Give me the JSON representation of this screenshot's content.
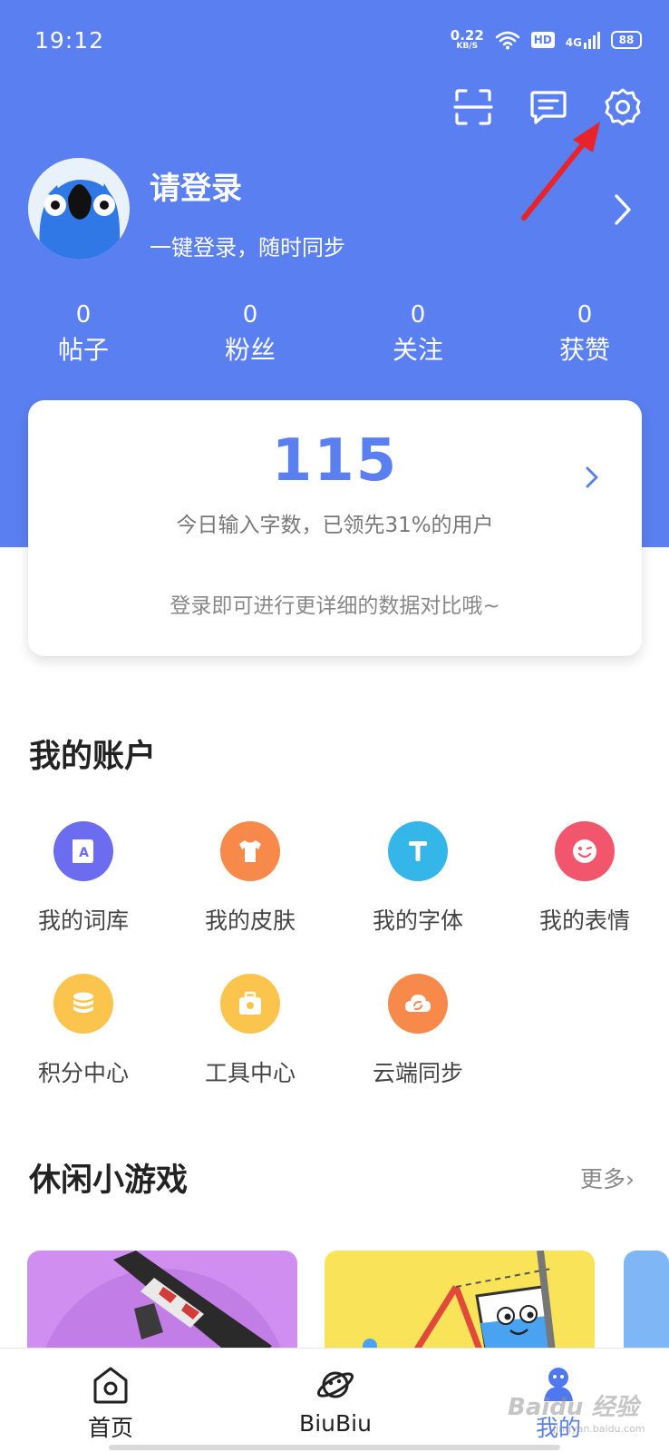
{
  "status_bar": {
    "time": "19:12",
    "net_speed_value": "0.22",
    "net_speed_unit": "KB/S",
    "hd_badge": "HD",
    "network_type": "4G",
    "battery_level": "88"
  },
  "top_icons": [
    "scan-icon",
    "message-icon",
    "settings-icon"
  ],
  "profile": {
    "title": "请登录",
    "subtitle": "一键登录，随时同步"
  },
  "stats": [
    {
      "value": "0",
      "label": "帖子"
    },
    {
      "value": "0",
      "label": "粉丝"
    },
    {
      "value": "0",
      "label": "关注"
    },
    {
      "value": "0",
      "label": "获赞"
    }
  ],
  "input_card": {
    "count": "115",
    "description": "今日输入字数，已领先31%的用户",
    "hint": "登录即可进行更详细的数据对比哦~"
  },
  "account_section": {
    "title": "我的账户",
    "items": [
      {
        "label": "我的词库",
        "icon": "dictionary-icon",
        "color": "#6b6cf0"
      },
      {
        "label": "我的皮肤",
        "icon": "tshirt-icon",
        "color": "#f7894a"
      },
      {
        "label": "我的字体",
        "icon": "font-icon",
        "color": "#34b6e8"
      },
      {
        "label": "我的表情",
        "icon": "emoji-icon",
        "color": "#f2566c"
      },
      {
        "label": "积分中心",
        "icon": "coins-icon",
        "color": "#fbc44c"
      },
      {
        "label": "工具中心",
        "icon": "toolbox-icon",
        "color": "#fbc44c"
      },
      {
        "label": "云端同步",
        "icon": "cloud-sync-icon",
        "color": "#f7894a"
      }
    ]
  },
  "games_section": {
    "title": "休闲小游戏",
    "more": "更多"
  },
  "bottom_nav": {
    "items": [
      {
        "label": "首页",
        "icon": "home-icon"
      },
      {
        "label": "BiuBiu",
        "icon": "planet-icon"
      },
      {
        "label": "我的",
        "icon": "profile-icon"
      }
    ],
    "active_index": 2
  },
  "watermark": {
    "text": "Baidu 经验",
    "sub": "jingyan.baidu.com"
  },
  "colors": {
    "primary": "#5a7ff0",
    "annotation": "#e8232a"
  }
}
